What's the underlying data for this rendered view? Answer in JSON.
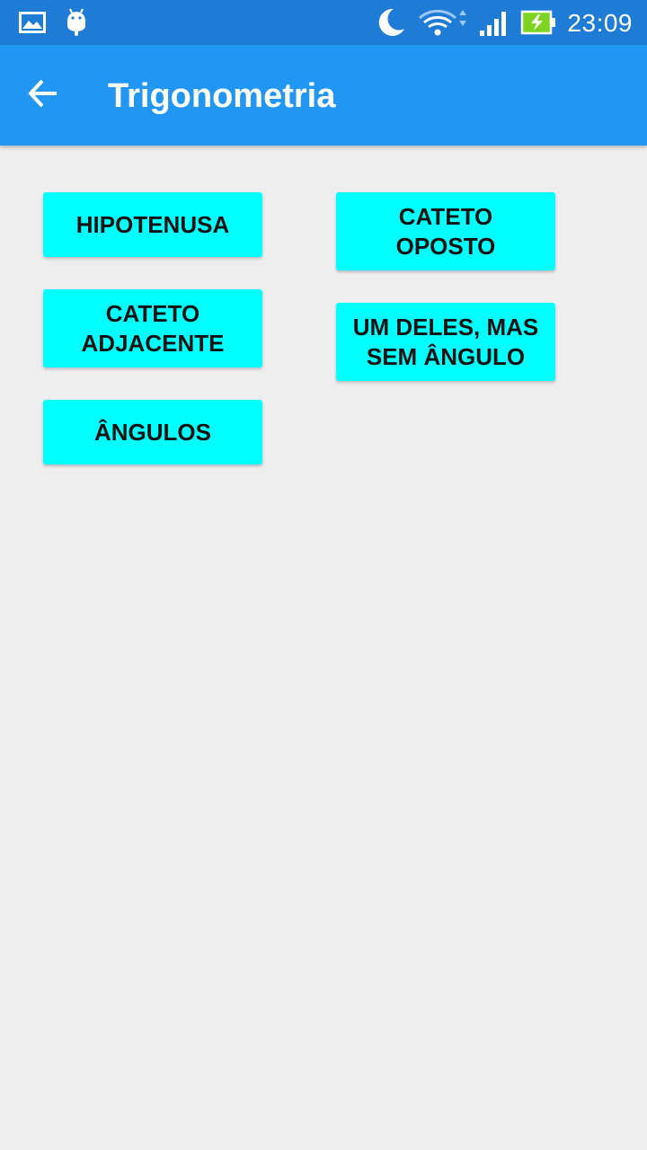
{
  "status_bar": {
    "time": "23:09",
    "icons": [
      "gallery-icon",
      "android-icon",
      "moon-icon",
      "wifi-icon",
      "signal-icon",
      "battery-charging-icon"
    ]
  },
  "app_bar": {
    "title": "Trigonometria",
    "back_icon": "arrow-back-icon"
  },
  "buttons": {
    "hipotenusa": {
      "line1": "HIPOTENUSA"
    },
    "cateto_oposto": {
      "line1": "CATETO",
      "line2": "OPOSTO"
    },
    "cateto_adjacente": {
      "line1": "CATETO",
      "line2": "ADJACENTE"
    },
    "um_deles": {
      "line1": "UM DELES, MAS",
      "line2": "SEM ÂNGULO"
    },
    "angulos": {
      "line1": "ÂNGULOS"
    }
  },
  "colors": {
    "status_bar": "#1e7bd6",
    "app_bar": "#2196f3",
    "button": "#00ffff",
    "background": "#eeeeee"
  }
}
